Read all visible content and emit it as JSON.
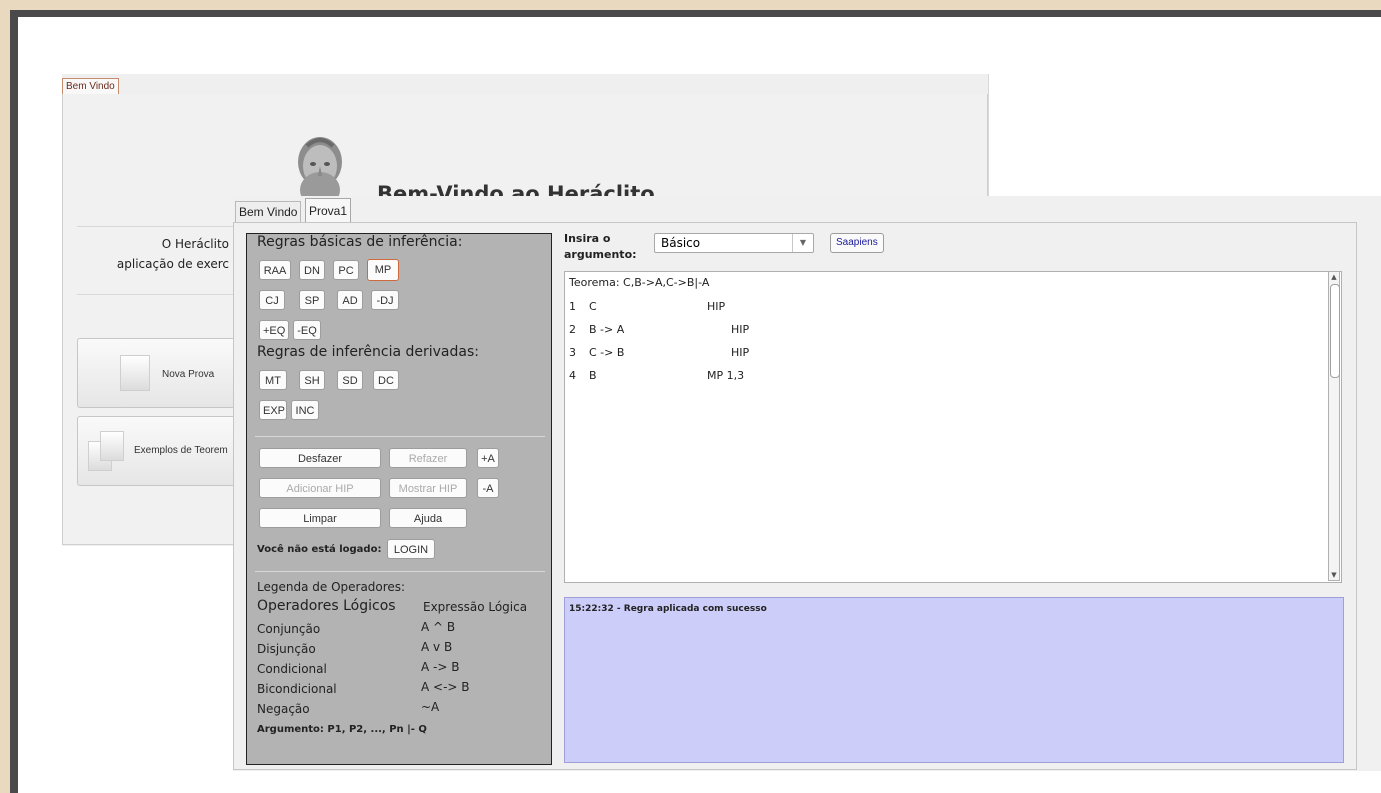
{
  "back_window": {
    "tab": "Bem Vindo",
    "title": "Bem-Vindo ao Heráclito",
    "desc_line1": "O Heráclito",
    "desc_line2": "aplicação de exerc",
    "buttons": [
      {
        "label": "Nova Prova",
        "icon": "document-icon"
      },
      {
        "label": "Exemplos de Teorem",
        "icon": "documents-icon"
      }
    ]
  },
  "front_window": {
    "tabs": [
      {
        "label": "Bem Vindo",
        "active": false
      },
      {
        "label": "Prova1",
        "active": true
      }
    ],
    "rules": {
      "basic_heading": "Regras básicas de inferência:",
      "basic_row1": [
        "RAA",
        "DN",
        "PC",
        "MP"
      ],
      "basic_row2": [
        "CJ",
        "SP",
        "AD",
        "-DJ"
      ],
      "basic_row3": [
        "+EQ",
        "-EQ"
      ],
      "derived_heading": "Regras de inferência derivadas:",
      "derived_row1": [
        "MT",
        "SH",
        "SD",
        "DC"
      ],
      "derived_row2": [
        "EXP",
        "INC"
      ],
      "selected": "MP",
      "actions": {
        "undo": "Desfazer",
        "redo": "Refazer",
        "plus_a": "+A",
        "add_hip": "Adicionar HIP",
        "show_hip": "Mostrar HIP",
        "minus_a": "-A",
        "clear": "Limpar",
        "help": "Ajuda"
      },
      "login_status": "Você não está logado:",
      "login_button": "LOGIN",
      "legend_title": "Legenda de Operadores:",
      "legend_col1": "Operadores Lógicos",
      "legend_col2": "Expressão Lógica",
      "operators": [
        {
          "name": "Conjunção",
          "expr": "A ^ B"
        },
        {
          "name": "Disjunção",
          "expr": "A v B"
        },
        {
          "name": "Condicional",
          "expr": "A -> B"
        },
        {
          "name": "Bicondicional",
          "expr": "A <-> B"
        },
        {
          "name": "Negação",
          "expr": "~A"
        }
      ],
      "argument_format": "Argumento: P1, P2, ..., Pn |- Q"
    },
    "input": {
      "label": "Insira o argumento:",
      "select_value": "Básico",
      "saapiens": "Saapiens"
    },
    "proof": {
      "theorem": "Teorema: C,B->A,C->B|-A",
      "lines": [
        {
          "n": "1",
          "formula": "C",
          "rule": "HIP"
        },
        {
          "n": "2",
          "formula": "B -> A",
          "rule": "HIP"
        },
        {
          "n": "3",
          "formula": "C -> B",
          "rule": "HIP"
        },
        {
          "n": "4",
          "formula": "B",
          "rule": "MP 1,3"
        }
      ]
    },
    "log_message": "15:22:32 - Regra aplicada com sucesso"
  },
  "colors": {
    "rules_panel": "#b3b3b3",
    "log_background": "#cccdf9",
    "selected_rule_border": "#d06a3c",
    "frame_beige": "#e8d9bf",
    "frame_dark": "#4a4a4a"
  }
}
